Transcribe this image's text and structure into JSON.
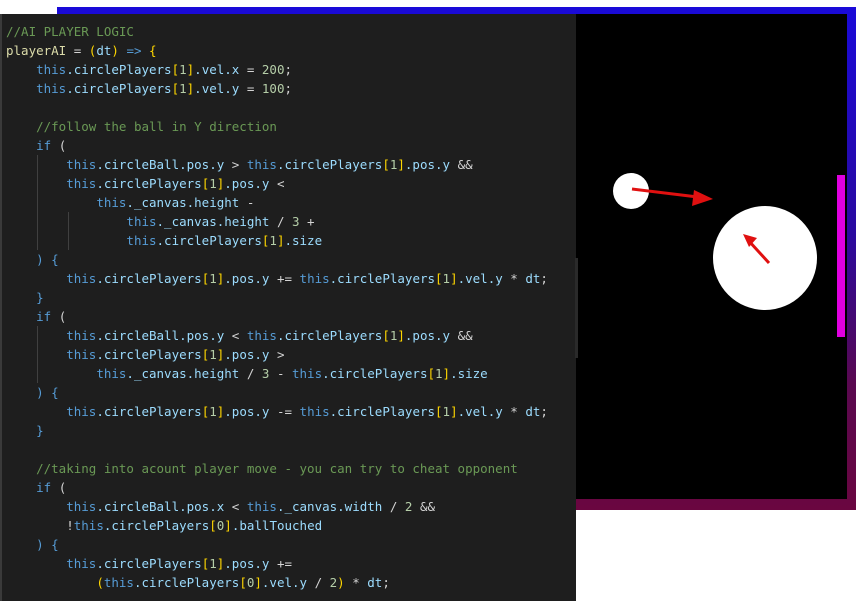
{
  "game": {
    "colors": {
      "frame_top": "#1a0ad8",
      "frame_bottom": "#6a0640",
      "background": "#000000",
      "paddle": "#e000e0",
      "arrow": "#e01010",
      "ball": "#ffffff"
    }
  },
  "code": {
    "lines": [
      [
        {
          "t": "//AI PLAYER LOGIC",
          "c": "cm"
        }
      ],
      [
        {
          "t": "playerAI",
          "c": "fn"
        },
        {
          "t": " = ",
          "c": "pn"
        },
        {
          "t": "(",
          "c": "br"
        },
        {
          "t": "dt",
          "c": "id"
        },
        {
          "t": ")",
          "c": "br"
        },
        {
          "t": " => ",
          "c": "kw"
        },
        {
          "t": "{",
          "c": "br"
        }
      ],
      [
        {
          "t": "    "
        },
        {
          "t": "this",
          "c": "tk"
        },
        {
          "t": ".circlePlayers",
          "c": "id"
        },
        {
          "t": "[",
          "c": "br"
        },
        {
          "t": "1",
          "c": "nm"
        },
        {
          "t": "]",
          "c": "br"
        },
        {
          "t": ".vel.x",
          "c": "id"
        },
        {
          "t": " = ",
          "c": "pn"
        },
        {
          "t": "200",
          "c": "nm"
        },
        {
          "t": ";",
          "c": "pn"
        }
      ],
      [
        {
          "t": "    "
        },
        {
          "t": "this",
          "c": "tk"
        },
        {
          "t": ".circlePlayers",
          "c": "id"
        },
        {
          "t": "[",
          "c": "br"
        },
        {
          "t": "1",
          "c": "nm"
        },
        {
          "t": "]",
          "c": "br"
        },
        {
          "t": ".vel.y",
          "c": "id"
        },
        {
          "t": " = ",
          "c": "pn"
        },
        {
          "t": "100",
          "c": "nm"
        },
        {
          "t": ";",
          "c": "pn"
        }
      ],
      [],
      [
        {
          "t": "    "
        },
        {
          "t": "//follow the ball in Y direction",
          "c": "cm"
        }
      ],
      [
        {
          "t": "    "
        },
        {
          "t": "if",
          "c": "kw"
        },
        {
          "t": " ("
        }
      ],
      [
        {
          "t": "        "
        },
        {
          "t": "this",
          "c": "tk"
        },
        {
          "t": ".circleBall.pos.y",
          "c": "id"
        },
        {
          "t": " > ",
          "c": "pn"
        },
        {
          "t": "this",
          "c": "tk"
        },
        {
          "t": ".circlePlayers",
          "c": "id"
        },
        {
          "t": "[",
          "c": "br"
        },
        {
          "t": "1",
          "c": "nm"
        },
        {
          "t": "]",
          "c": "br"
        },
        {
          "t": ".pos.y",
          "c": "id"
        },
        {
          "t": " &&",
          "c": "pn"
        }
      ],
      [
        {
          "t": "        "
        },
        {
          "t": "this",
          "c": "tk"
        },
        {
          "t": ".circlePlayers",
          "c": "id"
        },
        {
          "t": "[",
          "c": "br"
        },
        {
          "t": "1",
          "c": "nm"
        },
        {
          "t": "]",
          "c": "br"
        },
        {
          "t": ".pos.y",
          "c": "id"
        },
        {
          "t": " <",
          "c": "pn"
        }
      ],
      [
        {
          "t": "            "
        },
        {
          "t": "this",
          "c": "tk"
        },
        {
          "t": "._canvas.height",
          "c": "id"
        },
        {
          "t": " -",
          "c": "pn"
        }
      ],
      [
        {
          "t": "                "
        },
        {
          "t": "this",
          "c": "tk"
        },
        {
          "t": "._canvas.height",
          "c": "id"
        },
        {
          "t": " / ",
          "c": "pn"
        },
        {
          "t": "3",
          "c": "nm"
        },
        {
          "t": " +",
          "c": "pn"
        }
      ],
      [
        {
          "t": "                "
        },
        {
          "t": "this",
          "c": "tk"
        },
        {
          "t": ".circlePlayers",
          "c": "id"
        },
        {
          "t": "[",
          "c": "br"
        },
        {
          "t": "1",
          "c": "nm"
        },
        {
          "t": "]",
          "c": "br"
        },
        {
          "t": ".size",
          "c": "id"
        }
      ],
      [
        {
          "t": "    "
        },
        {
          "t": ") {",
          "c": "kw"
        }
      ],
      [
        {
          "t": "        "
        },
        {
          "t": "this",
          "c": "tk"
        },
        {
          "t": ".circlePlayers",
          "c": "id"
        },
        {
          "t": "[",
          "c": "br"
        },
        {
          "t": "1",
          "c": "nm"
        },
        {
          "t": "]",
          "c": "br"
        },
        {
          "t": ".pos.y",
          "c": "id"
        },
        {
          "t": " += ",
          "c": "pn"
        },
        {
          "t": "this",
          "c": "tk"
        },
        {
          "t": ".circlePlayers",
          "c": "id"
        },
        {
          "t": "[",
          "c": "br"
        },
        {
          "t": "1",
          "c": "nm"
        },
        {
          "t": "]",
          "c": "br"
        },
        {
          "t": ".vel.y",
          "c": "id"
        },
        {
          "t": " * ",
          "c": "pn"
        },
        {
          "t": "dt",
          "c": "id"
        },
        {
          "t": ";",
          "c": "pn"
        }
      ],
      [
        {
          "t": "    "
        },
        {
          "t": "}",
          "c": "kw"
        }
      ],
      [
        {
          "t": "    "
        },
        {
          "t": "if",
          "c": "kw"
        },
        {
          "t": " ("
        }
      ],
      [
        {
          "t": "        "
        },
        {
          "t": "this",
          "c": "tk"
        },
        {
          "t": ".circleBall.pos.y",
          "c": "id"
        },
        {
          "t": " < ",
          "c": "pn"
        },
        {
          "t": "this",
          "c": "tk"
        },
        {
          "t": ".circlePlayers",
          "c": "id"
        },
        {
          "t": "[",
          "c": "br"
        },
        {
          "t": "1",
          "c": "nm"
        },
        {
          "t": "]",
          "c": "br"
        },
        {
          "t": ".pos.y",
          "c": "id"
        },
        {
          "t": " &&",
          "c": "pn"
        }
      ],
      [
        {
          "t": "        "
        },
        {
          "t": "this",
          "c": "tk"
        },
        {
          "t": ".circlePlayers",
          "c": "id"
        },
        {
          "t": "[",
          "c": "br"
        },
        {
          "t": "1",
          "c": "nm"
        },
        {
          "t": "]",
          "c": "br"
        },
        {
          "t": ".pos.y",
          "c": "id"
        },
        {
          "t": " >",
          "c": "pn"
        }
      ],
      [
        {
          "t": "            "
        },
        {
          "t": "this",
          "c": "tk"
        },
        {
          "t": "._canvas.height",
          "c": "id"
        },
        {
          "t": " / ",
          "c": "pn"
        },
        {
          "t": "3",
          "c": "nm"
        },
        {
          "t": " - ",
          "c": "pn"
        },
        {
          "t": "this",
          "c": "tk"
        },
        {
          "t": ".circlePlayers",
          "c": "id"
        },
        {
          "t": "[",
          "c": "br"
        },
        {
          "t": "1",
          "c": "nm"
        },
        {
          "t": "]",
          "c": "br"
        },
        {
          "t": ".size",
          "c": "id"
        }
      ],
      [
        {
          "t": "    "
        },
        {
          "t": ") {",
          "c": "kw"
        }
      ],
      [
        {
          "t": "        "
        },
        {
          "t": "this",
          "c": "tk"
        },
        {
          "t": ".circlePlayers",
          "c": "id"
        },
        {
          "t": "[",
          "c": "br"
        },
        {
          "t": "1",
          "c": "nm"
        },
        {
          "t": "]",
          "c": "br"
        },
        {
          "t": ".pos.y",
          "c": "id"
        },
        {
          "t": " -= ",
          "c": "pn"
        },
        {
          "t": "this",
          "c": "tk"
        },
        {
          "t": ".circlePlayers",
          "c": "id"
        },
        {
          "t": "[",
          "c": "br"
        },
        {
          "t": "1",
          "c": "nm"
        },
        {
          "t": "]",
          "c": "br"
        },
        {
          "t": ".vel.y",
          "c": "id"
        },
        {
          "t": " * ",
          "c": "pn"
        },
        {
          "t": "dt",
          "c": "id"
        },
        {
          "t": ";",
          "c": "pn"
        }
      ],
      [
        {
          "t": "    "
        },
        {
          "t": "}",
          "c": "kw"
        }
      ],
      [],
      [
        {
          "t": "    "
        },
        {
          "t": "//taking into acount player move - you can try to cheat opponent",
          "c": "cm"
        }
      ],
      [
        {
          "t": "    "
        },
        {
          "t": "if",
          "c": "kw"
        },
        {
          "t": " ("
        }
      ],
      [
        {
          "t": "        "
        },
        {
          "t": "this",
          "c": "tk"
        },
        {
          "t": ".circleBall.pos.x",
          "c": "id"
        },
        {
          "t": " < ",
          "c": "pn"
        },
        {
          "t": "this",
          "c": "tk"
        },
        {
          "t": "._canvas.width",
          "c": "id"
        },
        {
          "t": " / ",
          "c": "pn"
        },
        {
          "t": "2",
          "c": "nm"
        },
        {
          "t": " &&",
          "c": "pn"
        }
      ],
      [
        {
          "t": "        "
        },
        {
          "t": "!",
          "c": "pn"
        },
        {
          "t": "this",
          "c": "tk"
        },
        {
          "t": ".circlePlayers",
          "c": "id"
        },
        {
          "t": "[",
          "c": "br"
        },
        {
          "t": "0",
          "c": "nm"
        },
        {
          "t": "]",
          "c": "br"
        },
        {
          "t": ".ballTouched",
          "c": "id"
        }
      ],
      [
        {
          "t": "    "
        },
        {
          "t": ") {",
          "c": "kw"
        }
      ],
      [
        {
          "t": "        "
        },
        {
          "t": "this",
          "c": "tk"
        },
        {
          "t": ".circlePlayers",
          "c": "id"
        },
        {
          "t": "[",
          "c": "br"
        },
        {
          "t": "1",
          "c": "nm"
        },
        {
          "t": "]",
          "c": "br"
        },
        {
          "t": ".pos.y",
          "c": "id"
        },
        {
          "t": " +=",
          "c": "pn"
        }
      ],
      [
        {
          "t": "            "
        },
        {
          "t": "(",
          "c": "br"
        },
        {
          "t": "this",
          "c": "tk"
        },
        {
          "t": ".circlePlayers",
          "c": "id"
        },
        {
          "t": "[",
          "c": "br"
        },
        {
          "t": "0",
          "c": "nm"
        },
        {
          "t": "]",
          "c": "br"
        },
        {
          "t": ".vel.y",
          "c": "id"
        },
        {
          "t": " / ",
          "c": "pn"
        },
        {
          "t": "2",
          "c": "nm"
        },
        {
          "t": ")",
          "c": "br"
        },
        {
          "t": " * ",
          "c": "pn"
        },
        {
          "t": "dt",
          "c": "id"
        },
        {
          "t": ";",
          "c": "pn"
        }
      ]
    ]
  }
}
